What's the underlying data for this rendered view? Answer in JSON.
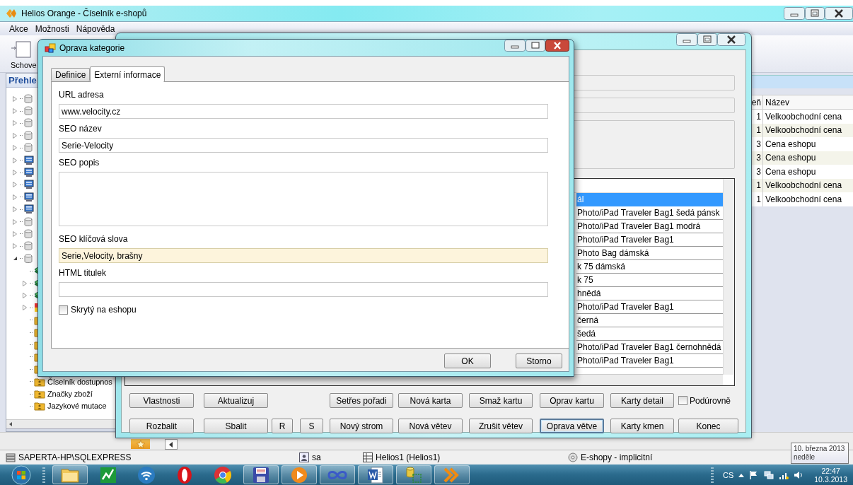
{
  "main_window": {
    "title": "Helios Orange - Číselník e-shopů",
    "menu": [
      "Akce",
      "Možnosti",
      "Nápověda"
    ],
    "toolbar_button": "Schove",
    "panel_title": "Přehle",
    "tree": [
      {
        "kind": "database",
        "expanded": false
      },
      {
        "kind": "database",
        "expanded": false
      },
      {
        "kind": "database",
        "expanded": false
      },
      {
        "kind": "database",
        "expanded": false
      },
      {
        "kind": "database",
        "expanded": false
      },
      {
        "kind": "monitor",
        "expanded": false
      },
      {
        "kind": "monitor",
        "expanded": false
      },
      {
        "kind": "monitor",
        "expanded": false
      },
      {
        "kind": "monitor",
        "expanded": false
      },
      {
        "kind": "monitor",
        "expanded": false
      },
      {
        "kind": "database",
        "expanded": false
      },
      {
        "kind": "database",
        "expanded": false
      },
      {
        "kind": "database",
        "expanded": false
      },
      {
        "kind": "database",
        "expanded": true,
        "children": [
          {
            "kind": "stack"
          },
          {
            "kind": "stack",
            "expanded": false
          },
          {
            "kind": "stack",
            "expanded": false
          },
          {
            "kind": "grid",
            "expanded": false
          },
          {
            "kind": "folder"
          },
          {
            "kind": "folder"
          },
          {
            "kind": "folder"
          },
          {
            "kind": "folder"
          },
          {
            "kind": "folder"
          },
          {
            "kind": "folder",
            "label": "Číselník dostupnos"
          },
          {
            "kind": "folder",
            "label": "Značky zboží"
          },
          {
            "kind": "folder",
            "label": "Jazykové mutace"
          }
        ]
      }
    ],
    "table": {
      "columns": [
        "eň",
        "Název"
      ],
      "rows": [
        [
          "1",
          "Velkoobchodní cena"
        ],
        [
          "1",
          "Velkoobchodní cena"
        ],
        [
          "3",
          "Cena eshopu"
        ],
        [
          "3",
          "Cena eshopu"
        ],
        [
          "3",
          "Cena eshopu"
        ],
        [
          "1",
          "Velkoobchodní cena"
        ],
        [
          "1",
          "Velkoobchodní cena"
        ]
      ]
    },
    "status_bar": [
      {
        "kind": "server",
        "text": "SAPERTA-HP\\SQLEXPRESS"
      },
      {
        "kind": "user",
        "text": "sa"
      },
      {
        "kind": "table",
        "text": "Helios1 (Helios1)"
      },
      {
        "kind": "disc",
        "text": "E-shopy - implicitní"
      }
    ]
  },
  "list_window": {
    "rows": [
      {
        "text": "ál",
        "selected": true
      },
      {
        "text": "Photo/iPad Traveler Bag1 šedá pánsk",
        "selected": false
      },
      {
        "text": "Photo/iPad Traveler Bag1 modrá",
        "selected": false
      },
      {
        "text": "Photo/iPad Traveler Bag1",
        "selected": false
      },
      {
        "text": "Photo Bag dámská",
        "selected": false
      },
      {
        "text": "k 75 dámská",
        "selected": false
      },
      {
        "text": "k 75",
        "selected": false
      },
      {
        "text": "hnědá",
        "selected": false
      },
      {
        "text": "Photo/iPad Traveler Bag1",
        "selected": false
      },
      {
        "text": "černá",
        "selected": false
      },
      {
        "text": "šedá",
        "selected": false
      },
      {
        "text": "Photo/iPad Traveler Bag1 černohnědá",
        "selected": false
      },
      {
        "text": "Photo/iPad Traveler Bag1",
        "selected": false
      }
    ],
    "buttons_row_1": [
      {
        "label": "Vlastnosti",
        "focused": false
      },
      {
        "label": "Aktualizuj",
        "focused": false
      },
      {
        "label": "Setřes pořadi",
        "focused": false
      },
      {
        "label": "Nová karta",
        "focused": false
      },
      {
        "label": "Smaž kartu",
        "focused": false
      },
      {
        "label": "Oprav kartu",
        "focused": false
      },
      {
        "label": "Karty detail",
        "focused": false
      }
    ],
    "subtree_checkbox": {
      "label": "Podúrovně",
      "checked": false
    },
    "buttons_row_2": [
      {
        "label": "Rozbalit",
        "focused": false
      },
      {
        "label": "Sbalit",
        "focused": false
      },
      {
        "label": "R",
        "focused": false
      },
      {
        "label": "S",
        "focused": false
      },
      {
        "label": "Nový strom",
        "focused": false
      },
      {
        "label": "Nová větev",
        "focused": false
      },
      {
        "label": "Zrušit větev",
        "focused": false
      },
      {
        "label": "Oprava větve",
        "focused": true
      },
      {
        "label": "Karty kmen",
        "focused": false
      },
      {
        "label": "Konec",
        "focused": false
      }
    ]
  },
  "dialog": {
    "title": "Oprava kategorie",
    "tabs": [
      {
        "label": "Definice",
        "selected": false
      },
      {
        "label": "Externí informace",
        "selected": true
      }
    ],
    "fields": [
      {
        "kind": "line",
        "label": "URL adresa",
        "value": "www.velocity.cz",
        "focused": false
      },
      {
        "kind": "line",
        "label": "SEO název",
        "value": "Serie-Velocity",
        "focused": false
      },
      {
        "kind": "area",
        "label": "SEO popis",
        "focused": false
      },
      {
        "kind": "line",
        "label": "SEO klíčová slova",
        "value": "Serie,Velocity, brašny",
        "focused": true
      },
      {
        "kind": "line",
        "label": "HTML titulek",
        "focused": false
      }
    ],
    "checkbox": {
      "label": "Skrytý na eshopu",
      "checked": false
    },
    "buttons": [
      "OK",
      "Storno"
    ]
  },
  "tooltip": {
    "lines": [
      "10. března 2013",
      "neděle"
    ]
  },
  "taskbar": {
    "apps": [
      {
        "kind": "folder",
        "running": true
      },
      {
        "kind": "chart",
        "running": false
      },
      {
        "kind": "wifi",
        "running": false
      },
      {
        "kind": "ring",
        "running": false
      },
      {
        "kind": "wheel",
        "running": false
      },
      {
        "kind": "floppy",
        "running": true
      },
      {
        "kind": "play",
        "running": true
      },
      {
        "kind": "infinity",
        "running": true
      },
      {
        "kind": "document",
        "running": true
      },
      {
        "kind": "cylinder",
        "running": true
      },
      {
        "kind": "chevron",
        "running": true
      }
    ],
    "language": "CS",
    "time": "22:47",
    "date": "10.3.2013"
  }
}
